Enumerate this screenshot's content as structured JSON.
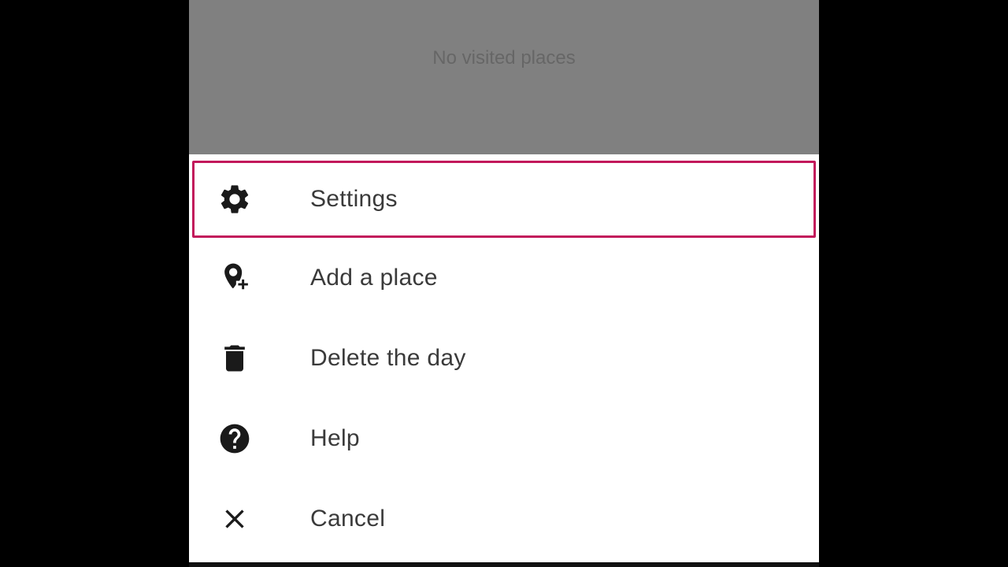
{
  "overlay": {
    "empty_text": "No visited places"
  },
  "menu": {
    "items": [
      {
        "label": "Settings",
        "icon": "gear-icon",
        "highlighted": true
      },
      {
        "label": "Add a place",
        "icon": "add-place-pin-icon",
        "highlighted": false
      },
      {
        "label": "Delete the day",
        "icon": "trash-icon",
        "highlighted": false
      },
      {
        "label": "Help",
        "icon": "help-circle-icon",
        "highlighted": false
      },
      {
        "label": "Cancel",
        "icon": "close-icon",
        "highlighted": false
      }
    ]
  },
  "colors": {
    "overlay": "#808080",
    "highlight_border": "#c2185b",
    "icon": "#1a1a1a",
    "text": "#3a3a3a"
  }
}
